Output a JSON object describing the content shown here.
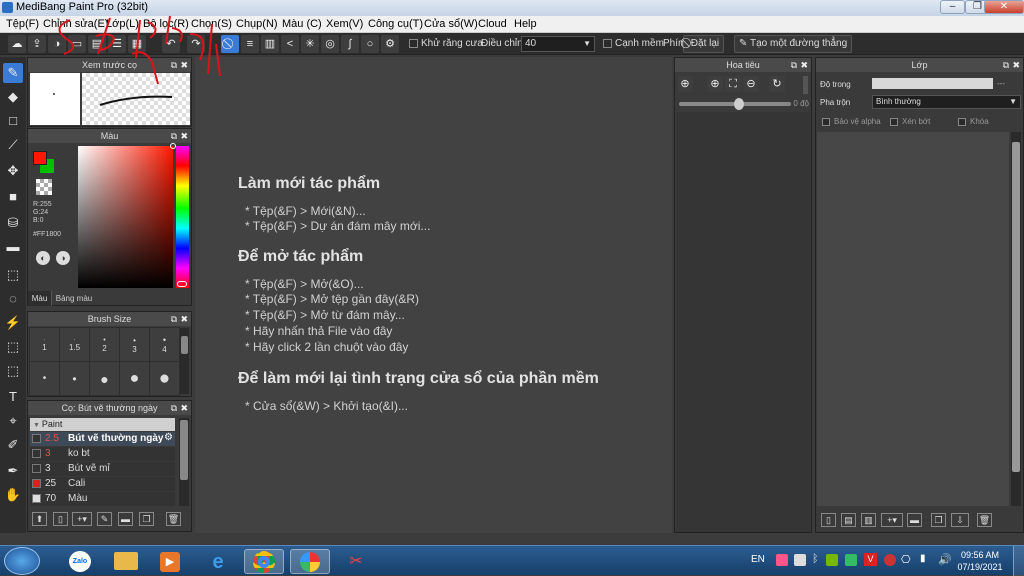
{
  "window": {
    "title": "MediBang Paint Pro (32bit)"
  },
  "menu": [
    "Tệp(F)",
    "Chỉnh sửa(E)",
    "Lớp(L)",
    "Bộ lọc(R)",
    "Chọn(S)",
    "Chụp(N)",
    "Màu (C)",
    "Xem(V)",
    "Công cụ(T)",
    "Cửa sổ(W)",
    "Cloud",
    "Help"
  ],
  "toolbar": {
    "antialias_label": "Khử răng cưa",
    "adjust_label": "Điều chỉnh",
    "adjust_value": "40",
    "canh_mem_label": "Cạnh mềm",
    "phim_label": "Phím",
    "reset_label": "Đặt lại",
    "straight_line_label": "Tạo một đường thẳng"
  },
  "preview_panel": {
    "title": "Xem trước cọ"
  },
  "color_panel": {
    "title": "Màu",
    "r": "R:255",
    "g": "G:24",
    "b": "B:0",
    "hex": "#FF1800",
    "tab_color": "Màu",
    "tab_palette": "Bảng màu",
    "primary": "#ff1800",
    "secondary": "#00c000"
  },
  "brush_size_panel": {
    "title": "Brush Size",
    "sizes_row1": [
      "1",
      "1.5",
      "2",
      "3",
      "4"
    ]
  },
  "brush_panel": {
    "title": "Cọ: Bút vẽ thường ngày",
    "group": "Paint",
    "brushes": [
      {
        "size": "2.5",
        "name": "Bút vẽ thường ngày",
        "color": "#333"
      },
      {
        "size": "3",
        "name": "ko bt",
        "color": "#333"
      },
      {
        "size": "3",
        "name": "Bút vẽ mỉ",
        "color": "#333"
      },
      {
        "size": "25",
        "name": "Cali",
        "color": "#e02020"
      },
      {
        "size": "70",
        "name": "Màu",
        "color": "#dddddd"
      }
    ]
  },
  "canvas_help": {
    "h1": "Làm mới tác phẩm",
    "h1_items": [
      "* Tệp(&F) > Mới(&N)...",
      "* Tệp(&F) > Dự án đám mây mới..."
    ],
    "h2": "Để mở tác phẩm",
    "h2_items": [
      "* Tệp(&F) > Mở(&O)...",
      "* Tệp(&F) > Mở tệp gần đây(&R)",
      "* Tệp(&F) > Mở từ đám mây...",
      "* Hãy nhấn thả File vào đây",
      "* Hãy click 2 lần chuột vào đây"
    ],
    "h3": "Để làm mới lại tình trạng cửa sổ của phần mềm",
    "h3_items": [
      "* Cửa sổ(&W) > Khởi tạo(&I)..."
    ]
  },
  "navigator": {
    "title": "Hoa tiêu",
    "angle": "0 độ"
  },
  "layer_panel": {
    "title": "Lớp",
    "opacity_label": "Độ trong",
    "opacity_value": "---",
    "blend_label": "Pha trộn",
    "blend_value": "Bình thường",
    "protect_alpha": "Bảo vệ alpha",
    "clipping": "Xén bớt",
    "lock": "Khóa"
  },
  "taskbar": {
    "lang": "EN",
    "time": "09:56 AM",
    "date": "07/19/2021",
    "zalo": "Zalo"
  }
}
